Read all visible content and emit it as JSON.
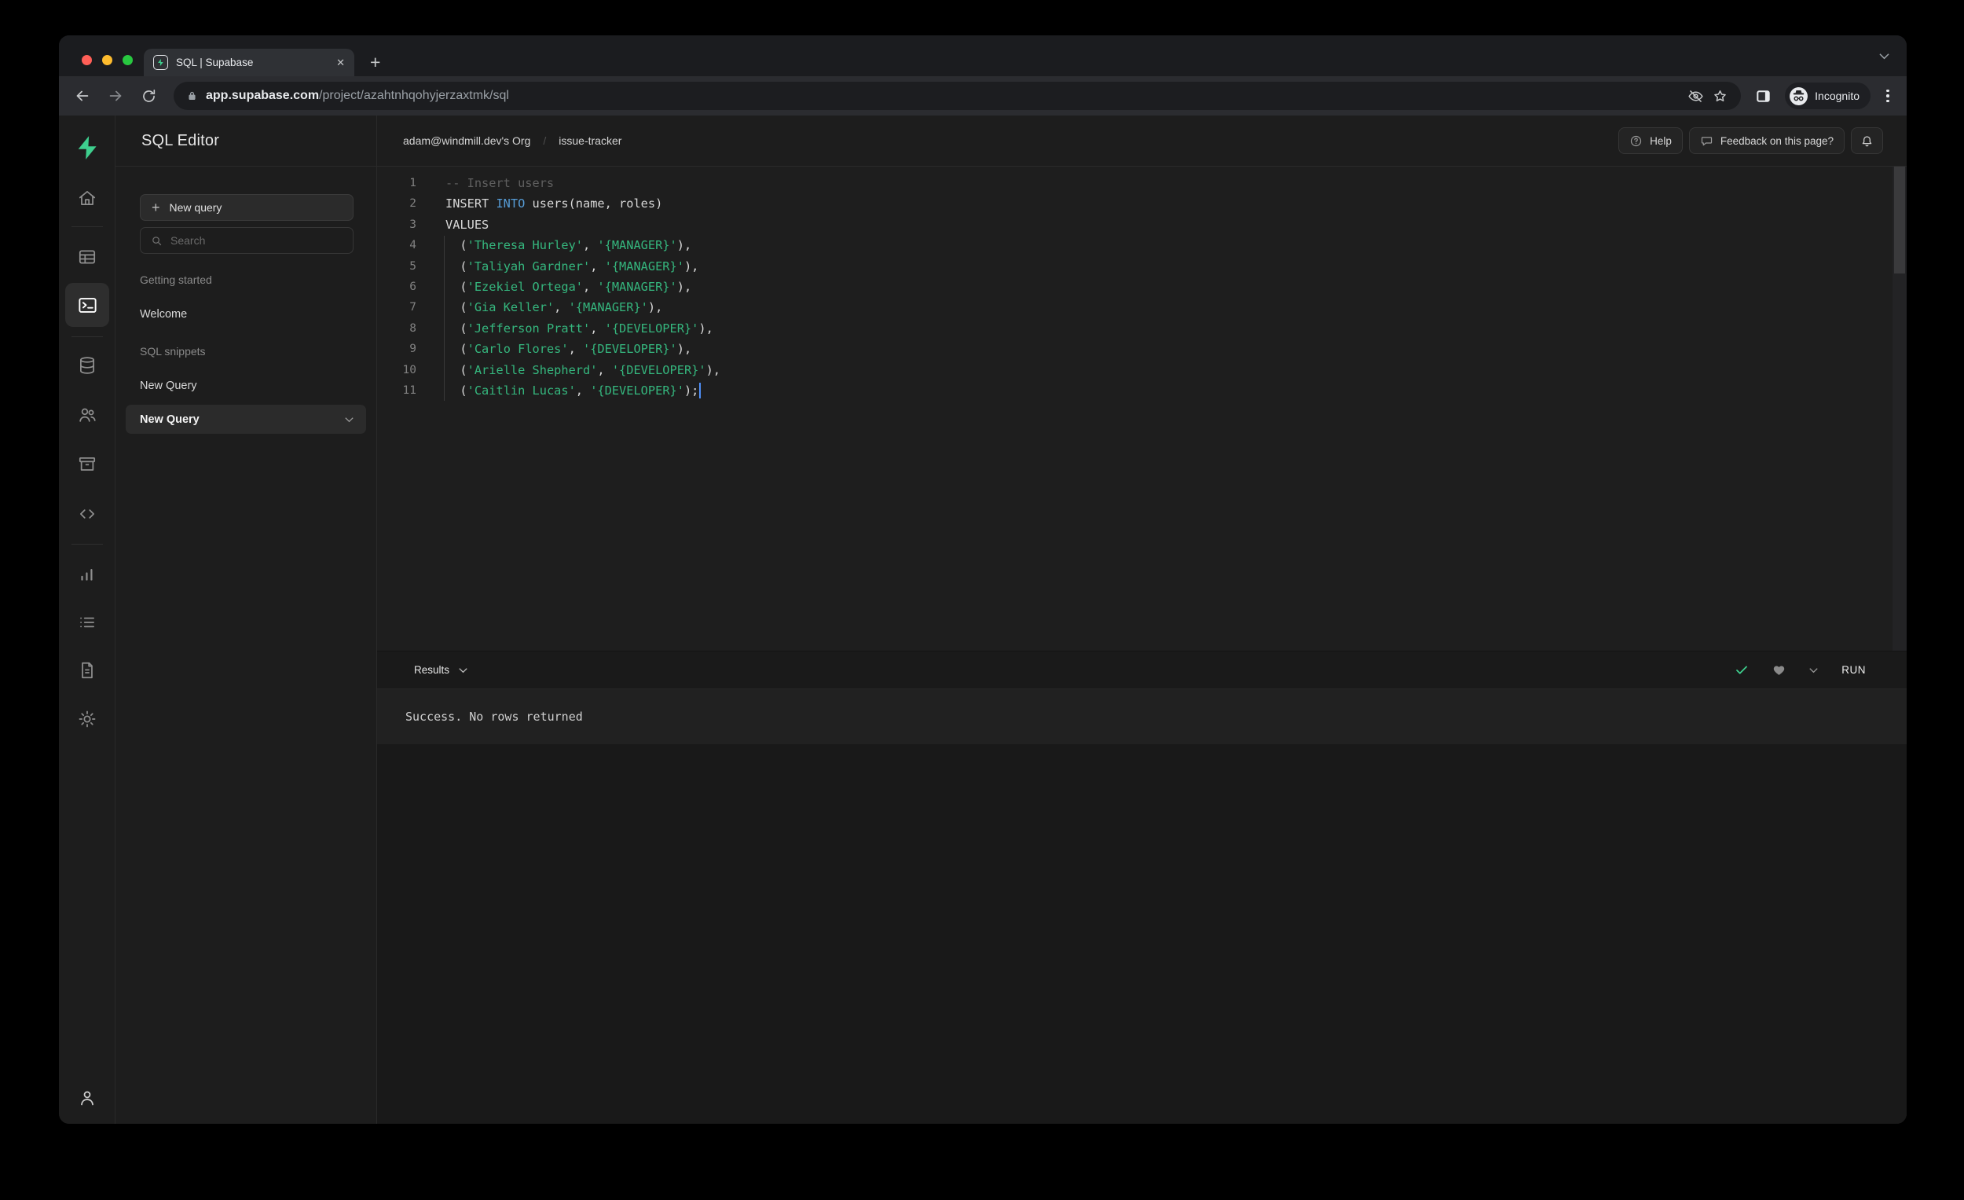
{
  "browser": {
    "tab_title": "SQL | Supabase",
    "url_host": "app.supabase.com",
    "url_path": "/project/azahtnhqohyjerzaxtmk/sql",
    "incognito_label": "Incognito"
  },
  "rail_icons": [
    "supabase-logo",
    "home",
    "table-editor",
    "sql-editor",
    "database",
    "authentication",
    "storage",
    "edge-functions",
    "reports",
    "logs",
    "api-docs",
    "project-settings",
    "account"
  ],
  "panel": {
    "title": "SQL Editor",
    "new_query_label": "New query",
    "search_placeholder": "Search",
    "sections": [
      {
        "label": "Getting started",
        "items": [
          {
            "label": "Welcome",
            "active": false
          }
        ]
      },
      {
        "label": "SQL snippets",
        "items": [
          {
            "label": "New Query",
            "active": false
          },
          {
            "label": "New Query",
            "active": true
          }
        ]
      }
    ]
  },
  "header": {
    "breadcrumb_org": "adam@windmill.dev's Org",
    "breadcrumb_separator": "/",
    "breadcrumb_project": "issue-tracker",
    "help_label": "Help",
    "feedback_label": "Feedback on this page?"
  },
  "editor": {
    "cursor_visible": true,
    "lines": [
      {
        "segments": [
          [
            "comment",
            "-- Insert users"
          ]
        ]
      },
      {
        "segments": [
          [
            "plain",
            "INSERT "
          ],
          [
            "keyword",
            "INTO"
          ],
          [
            "plain",
            " users(name, roles)"
          ]
        ]
      },
      {
        "segments": [
          [
            "plain",
            "VALUES"
          ]
        ]
      },
      {
        "segments": [
          [
            "plain",
            "  ("
          ],
          [
            "string",
            "'Theresa Hurley'"
          ],
          [
            "plain",
            ", "
          ],
          [
            "string",
            "'{MANAGER}'"
          ],
          [
            "plain",
            "),"
          ]
        ]
      },
      {
        "segments": [
          [
            "plain",
            "  ("
          ],
          [
            "string",
            "'Taliyah Gardner'"
          ],
          [
            "plain",
            ", "
          ],
          [
            "string",
            "'{MANAGER}'"
          ],
          [
            "plain",
            "),"
          ]
        ]
      },
      {
        "segments": [
          [
            "plain",
            "  ("
          ],
          [
            "string",
            "'Ezekiel Ortega'"
          ],
          [
            "plain",
            ", "
          ],
          [
            "string",
            "'{MANAGER}'"
          ],
          [
            "plain",
            "),"
          ]
        ]
      },
      {
        "segments": [
          [
            "plain",
            "  ("
          ],
          [
            "string",
            "'Gia Keller'"
          ],
          [
            "plain",
            ", "
          ],
          [
            "string",
            "'{MANAGER}'"
          ],
          [
            "plain",
            "),"
          ]
        ]
      },
      {
        "segments": [
          [
            "plain",
            "  ("
          ],
          [
            "string",
            "'Jefferson Pratt'"
          ],
          [
            "plain",
            ", "
          ],
          [
            "string",
            "'{DEVELOPER}'"
          ],
          [
            "plain",
            "),"
          ]
        ]
      },
      {
        "segments": [
          [
            "plain",
            "  ("
          ],
          [
            "string",
            "'Carlo Flores'"
          ],
          [
            "plain",
            ", "
          ],
          [
            "string",
            "'{DEVELOPER}'"
          ],
          [
            "plain",
            "),"
          ]
        ]
      },
      {
        "segments": [
          [
            "plain",
            "  ("
          ],
          [
            "string",
            "'Arielle Shepherd'"
          ],
          [
            "plain",
            ", "
          ],
          [
            "string",
            "'{DEVELOPER}'"
          ],
          [
            "plain",
            "),"
          ]
        ]
      },
      {
        "segments": [
          [
            "plain",
            "  ("
          ],
          [
            "string",
            "'Caitlin Lucas'"
          ],
          [
            "plain",
            ", "
          ],
          [
            "string",
            "'{DEVELOPER}'"
          ],
          [
            "plain",
            ");"
          ]
        ]
      }
    ]
  },
  "results": {
    "dropdown_label": "Results",
    "run_label": "RUN",
    "message": "Success. No rows returned"
  },
  "colors": {
    "accent_green": "#3ECF8E",
    "keyword_blue": "#569CD6",
    "string_green": "#35B77E",
    "comment_gray": "#5F5F5F",
    "cursor_blue": "#4F8FF7",
    "traffic_red": "#FF5F57",
    "traffic_yellow": "#FEBC2E",
    "traffic_green": "#28C840"
  }
}
